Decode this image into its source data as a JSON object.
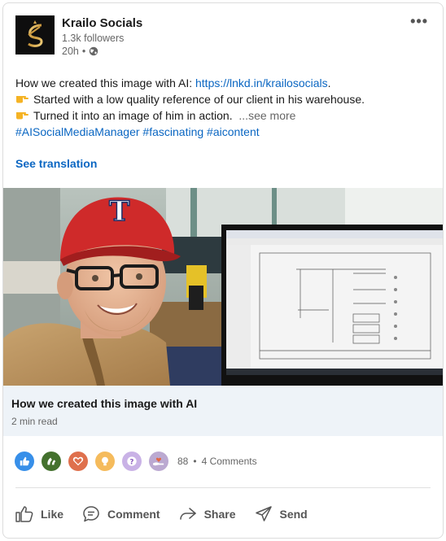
{
  "author": {
    "name": "Krailo Socials",
    "followers": "1.3k followers",
    "time": "20h",
    "visibility_sep": "•"
  },
  "post": {
    "intro": "How we created this image with AI: ",
    "link": "https://lnkd.in/krailosocials",
    "intro_end": ".",
    "bullet1": "Started with a low quality reference of our client in his warehouse.",
    "bullet2": "Turned it into an image of him in action.",
    "see_more": "...see more",
    "hashtags": "#AISocialMediaManager #fascinating #aicontent",
    "see_translation": "See translation"
  },
  "article": {
    "title": "How we created this image with AI",
    "read_time": "2 min read"
  },
  "social": {
    "reaction_icons": [
      "like-icon",
      "celebrate-icon",
      "love-icon",
      "insightful-icon",
      "curious-icon",
      "support-icon"
    ],
    "reaction_count": "88",
    "separator": "•",
    "comments": "4 Comments"
  },
  "actions": {
    "like": "Like",
    "comment": "Comment",
    "share": "Share",
    "send": "Send"
  },
  "colors": {
    "link": "#0a66c2",
    "muted": "#666666",
    "article_bg": "#eef3f8",
    "cap_red": "#cf2a2a"
  }
}
